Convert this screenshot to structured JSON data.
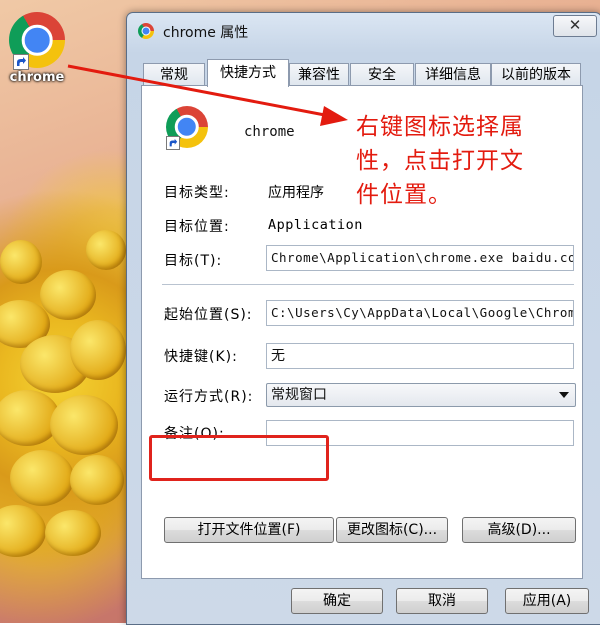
{
  "desktop": {
    "shortcut_label": "chrome"
  },
  "dialog": {
    "title": "chrome 属性",
    "close_symbol": "✕",
    "tabs": [
      {
        "label": "常规"
      },
      {
        "label": "快捷方式"
      },
      {
        "label": "兼容性"
      },
      {
        "label": "安全"
      },
      {
        "label": "详细信息"
      },
      {
        "label": "以前的版本"
      }
    ],
    "active_tab": "快捷方式",
    "shortcut": {
      "name": "chrome",
      "target_type_label": "目标类型:",
      "target_type_value": "应用程序",
      "target_location_label": "目标位置:",
      "target_location_value": "Application",
      "target_label": "目标(T):",
      "target_value": "Chrome\\Application\\chrome.exe baidu.com",
      "start_in_label": "起始位置(S):",
      "start_in_value": "C:\\Users\\Cy\\AppData\\Local\\Google\\Chrome",
      "hotkey_label": "快捷键(K):",
      "hotkey_value": "无",
      "run_label": "运行方式(R):",
      "run_value": "常规窗口",
      "comment_label": "备注(O):",
      "comment_value": "",
      "open_location_button": "打开文件位置(F)",
      "change_icon_button": "更改图标(C)...",
      "advanced_button": "高级(D)..."
    },
    "footer": {
      "ok_button": "确定",
      "cancel_button": "取消",
      "apply_button": "应用(A)"
    }
  },
  "annotation": {
    "line1": "右键图标选择属",
    "line2": "性，点击打开文",
    "line3": "件位置。",
    "color": "#e31b0f"
  }
}
